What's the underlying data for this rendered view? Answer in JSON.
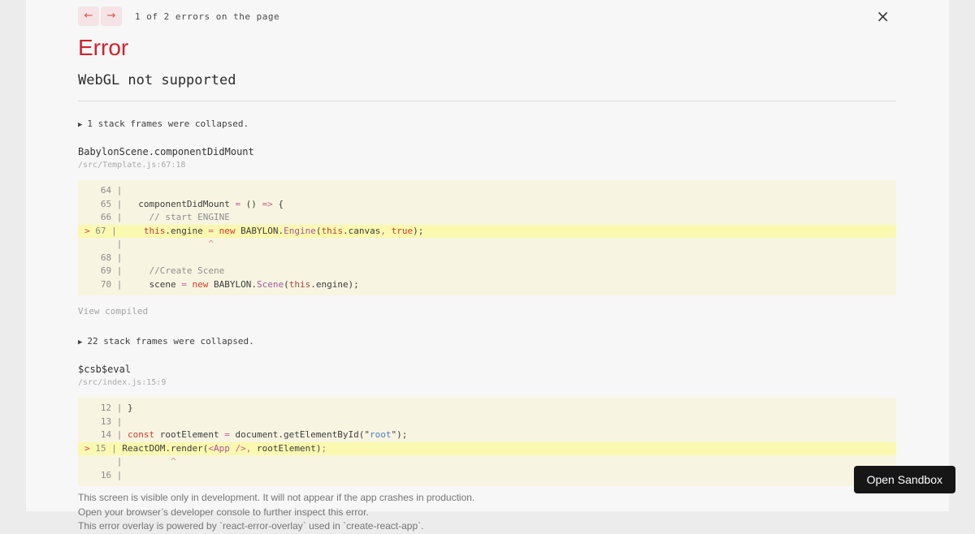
{
  "nav": {
    "prev_icon": "←",
    "next_icon": "→",
    "label": "1 of 2 errors on the page",
    "close_icon": "×"
  },
  "error": {
    "title": "Error",
    "message": "WebGL not supported"
  },
  "colors": {
    "error_red": "#ce242e",
    "overlay_bg": "#f7f7f7",
    "code_bg": "#f7f5e1",
    "code_highlight_bg": "#fbf9af",
    "keyword": "#d43b2f",
    "operator": "#c75b95",
    "class_name": "#a257a2",
    "string": "#4a7fc1",
    "sandbox_btn_bg": "#161616"
  },
  "frames": [
    {
      "collapse_icon": "▶",
      "collapse_text": "1 stack frames were collapsed.",
      "fn": "BabylonScene.componentDidMount",
      "path": "/src/Template.js:67:18",
      "view_compiled": "View compiled",
      "code": {
        "lines": [
          {
            "highlight": false,
            "segments": [
              {
                "t": "   64 | ",
                "c": "ln"
              }
            ]
          },
          {
            "highlight": false,
            "segments": [
              {
                "t": "   65 | ",
                "c": "ln"
              },
              {
                "t": "  componentDidMount ",
                "c": "pl"
              },
              {
                "t": "=",
                "c": "op"
              },
              {
                "t": " () ",
                "c": "pl"
              },
              {
                "t": "=>",
                "c": "op"
              },
              {
                "t": " {",
                "c": "pl"
              }
            ]
          },
          {
            "highlight": false,
            "segments": [
              {
                "t": "   66 | ",
                "c": "ln"
              },
              {
                "t": "    // start ENGINE",
                "c": "cm"
              }
            ]
          },
          {
            "highlight": true,
            "segments": [
              {
                "t": "> ",
                "c": "mk"
              },
              {
                "t": "67 | ",
                "c": "ln"
              },
              {
                "t": "    ",
                "c": "pl"
              },
              {
                "t": "this",
                "c": "th"
              },
              {
                "t": ".engine ",
                "c": "pl"
              },
              {
                "t": "=",
                "c": "op"
              },
              {
                "t": " ",
                "c": "pl"
              },
              {
                "t": "new",
                "c": "kw"
              },
              {
                "t": " BABYLON.",
                "c": "pl"
              },
              {
                "t": "Engine",
                "c": "cls"
              },
              {
                "t": "(",
                "c": "pl"
              },
              {
                "t": "this",
                "c": "th"
              },
              {
                "t": ".canvas",
                "c": "pl"
              },
              {
                "t": ",",
                "c": "op"
              },
              {
                "t": " ",
                "c": "pl"
              },
              {
                "t": "true",
                "c": "kw"
              },
              {
                "t": ");",
                "c": "pl"
              }
            ]
          },
          {
            "highlight": false,
            "segments": [
              {
                "t": "      | ",
                "c": "ln"
              },
              {
                "t": "               ",
                "c": "pl"
              },
              {
                "t": "^",
                "c": "ct"
              }
            ]
          },
          {
            "highlight": false,
            "segments": [
              {
                "t": "   68 | ",
                "c": "ln"
              }
            ]
          },
          {
            "highlight": false,
            "segments": [
              {
                "t": "   69 | ",
                "c": "ln"
              },
              {
                "t": "    //Create Scene",
                "c": "cm"
              }
            ]
          },
          {
            "highlight": false,
            "segments": [
              {
                "t": "   70 | ",
                "c": "ln"
              },
              {
                "t": "    scene ",
                "c": "pl"
              },
              {
                "t": "=",
                "c": "op"
              },
              {
                "t": " ",
                "c": "pl"
              },
              {
                "t": "new",
                "c": "kw"
              },
              {
                "t": " BABYLON.",
                "c": "pl"
              },
              {
                "t": "Scene",
                "c": "cls"
              },
              {
                "t": "(",
                "c": "pl"
              },
              {
                "t": "this",
                "c": "th"
              },
              {
                "t": ".engine);",
                "c": "pl"
              }
            ]
          }
        ]
      }
    },
    {
      "collapse_icon": "▶",
      "collapse_text": "22 stack frames were collapsed.",
      "fn": "$csb$eval",
      "path": "/src/index.js:15:9",
      "code": {
        "lines": [
          {
            "highlight": false,
            "segments": [
              {
                "t": "   12 | ",
                "c": "ln"
              },
              {
                "t": "}",
                "c": "pl"
              }
            ]
          },
          {
            "highlight": false,
            "segments": [
              {
                "t": "   13 | ",
                "c": "ln"
              }
            ]
          },
          {
            "highlight": false,
            "segments": [
              {
                "t": "   14 | ",
                "c": "ln"
              },
              {
                "t": "const",
                "c": "kw"
              },
              {
                "t": " rootElement ",
                "c": "pl"
              },
              {
                "t": "=",
                "c": "op"
              },
              {
                "t": " document.getElementById(\"",
                "c": "pl"
              },
              {
                "t": "root",
                "c": "str"
              },
              {
                "t": "\");",
                "c": "pl"
              }
            ]
          },
          {
            "highlight": true,
            "segments": [
              {
                "t": "> ",
                "c": "mk"
              },
              {
                "t": "15 | ",
                "c": "ln"
              },
              {
                "t": "ReactDOM.render(",
                "c": "pl"
              },
              {
                "t": "<",
                "c": "op"
              },
              {
                "t": "App",
                "c": "cls"
              },
              {
                "t": " ",
                "c": "pl"
              },
              {
                "t": "/>",
                "c": "op"
              },
              {
                "t": ",",
                "c": "op"
              },
              {
                "t": " rootElement)",
                "c": "pl"
              },
              {
                "t": ";",
                "c": "op"
              }
            ]
          },
          {
            "highlight": false,
            "segments": [
              {
                "t": "      | ",
                "c": "ln"
              },
              {
                "t": "        ",
                "c": "pl"
              },
              {
                "t": "^",
                "c": "ct"
              }
            ]
          },
          {
            "highlight": false,
            "segments": [
              {
                "t": "   16 | ",
                "c": "ln"
              }
            ]
          }
        ]
      }
    }
  ],
  "footer": {
    "lines": [
      "This screen is visible only in development. It will not appear if the app crashes in production.",
      "Open your browser’s developer console to further inspect this error.",
      "This error overlay is powered by `react-error-overlay` used in `create-react-app`."
    ]
  },
  "sandbox": {
    "label": "Open Sandbox"
  }
}
